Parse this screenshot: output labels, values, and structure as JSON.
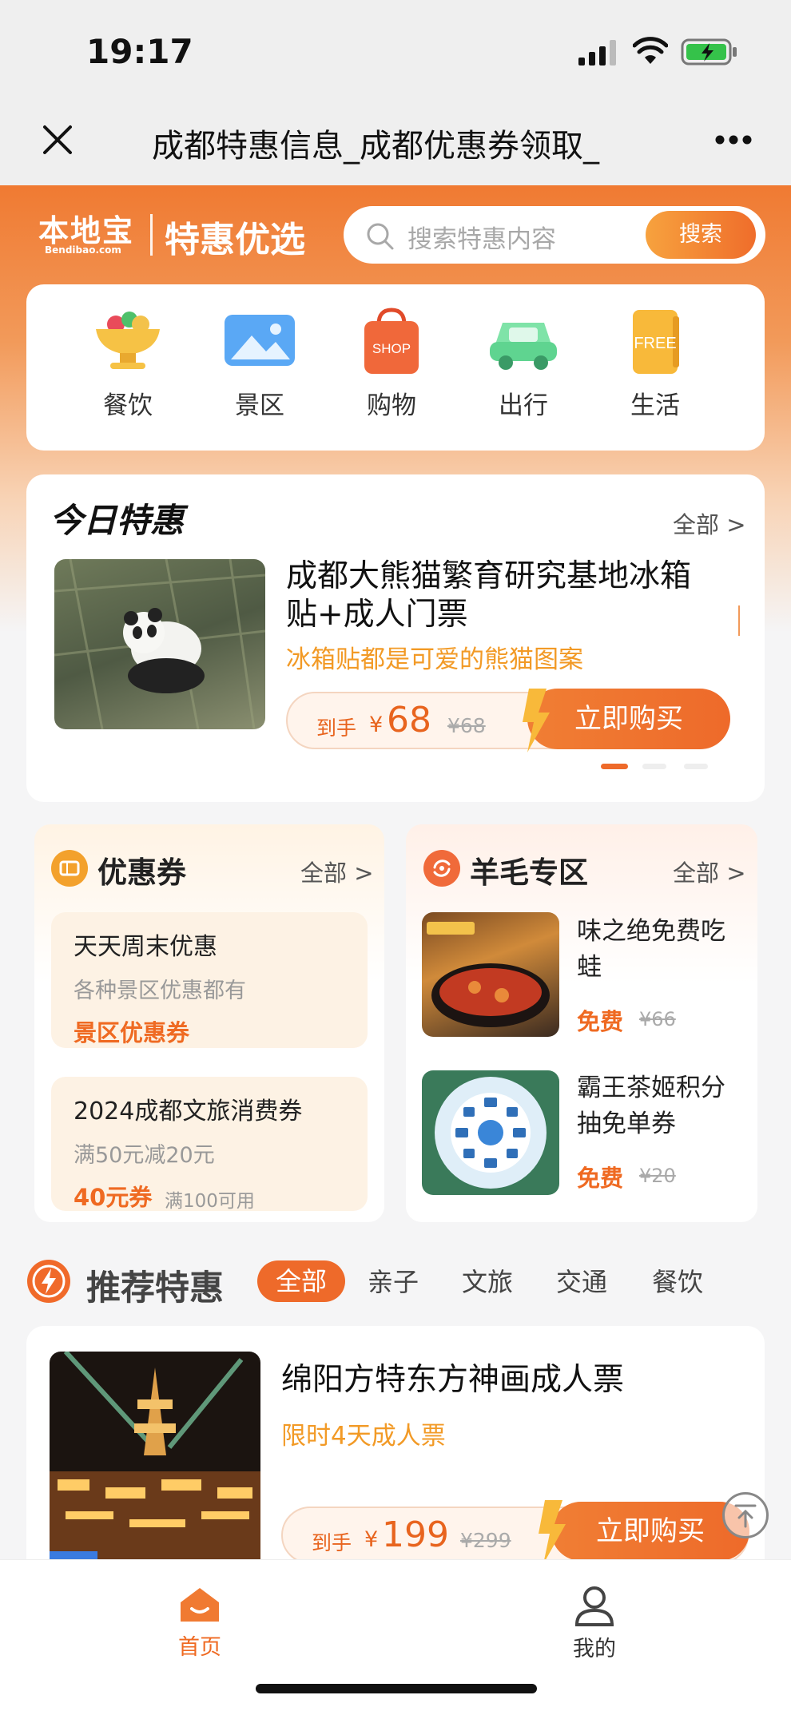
{
  "status": {
    "time": "19:17"
  },
  "nav": {
    "title": "成都特惠信息_成都优惠券领取_",
    "close_icon": "close-icon",
    "more_icon": "more-icon"
  },
  "brand": {
    "logo": "本地宝",
    "logo_sub": "Bendibao.com",
    "slogan": "特惠优选"
  },
  "search": {
    "placeholder": "搜索特惠内容",
    "button": "搜索"
  },
  "categories": [
    {
      "label": "餐饮",
      "icon": "food-bowl-icon"
    },
    {
      "label": "景区",
      "icon": "scenery-icon"
    },
    {
      "label": "购物",
      "icon": "shopping-bag-icon"
    },
    {
      "label": "出行",
      "icon": "car-icon"
    },
    {
      "label": "生活",
      "icon": "life-icon",
      "icon_text": "FREE"
    }
  ],
  "today": {
    "title": "今日特惠",
    "more": "全部 >",
    "deal": {
      "title": "成都大熊猫繁育研究基地冰箱贴+成人门票",
      "subtitle": "冰箱贴都是可爱的熊猫图案",
      "price_prefix": "到手",
      "currency": "¥",
      "price": "68",
      "old_price": "¥68",
      "buy": "立即购买"
    }
  },
  "coupons": {
    "title": "优惠券",
    "more": "全部 >",
    "items": [
      {
        "title": "天天周末优惠",
        "sub": "各种景区优惠都有",
        "tag": "景区优惠券",
        "note": ""
      },
      {
        "title": "2024成都文旅消费券",
        "sub": "满50元减20元",
        "tag": "40元券",
        "note": "满100可用"
      }
    ]
  },
  "wool": {
    "title": "羊毛专区",
    "more": "全部 >",
    "items": [
      {
        "title": "味之绝免费吃蛙",
        "free": "免费",
        "old": "¥66"
      },
      {
        "title": "霸王茶姬积分抽免单券",
        "free": "免费",
        "old": "¥20"
      }
    ]
  },
  "recommend": {
    "title": "推荐特惠",
    "tabs": [
      "全部",
      "亲子",
      "文旅",
      "交通",
      "餐饮"
    ],
    "item": {
      "title": "绵阳方特东方神画成人票",
      "subtitle": "限时4天成人票",
      "price_prefix": "到手",
      "currency": "¥",
      "price": "199",
      "old_price": "¥299",
      "buy": "立即购买"
    }
  },
  "tabbar": {
    "home": "首页",
    "mine": "我的"
  },
  "colors": {
    "accent": "#ee6a2a",
    "gold": "#f29a26"
  }
}
